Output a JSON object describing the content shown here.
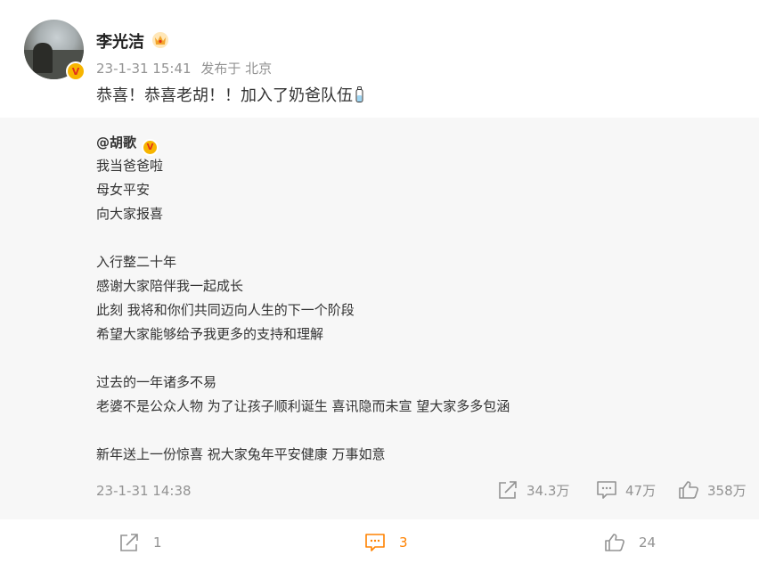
{
  "post": {
    "username": "李光洁",
    "timestamp": "23-1-31 15:41",
    "location": "发布于 北京",
    "text": "恭喜！恭喜老胡！！加入了奶爸队伍"
  },
  "repost": {
    "author": "@胡歌",
    "lines": [
      "我当爸爸啦",
      "母女平安",
      "向大家报喜",
      "",
      "入行整二十年",
      "感谢大家陪伴我一起成长",
      "此刻 我将和你们共同迈向人生的下一个阶段",
      "希望大家能够给予我更多的支持和理解",
      "",
      "过去的一年诸多不易",
      "老婆不是公众人物 为了让孩子顺利诞生 喜讯隐而未宣 望大家多多包涵",
      "",
      "新年送上一份惊喜 祝大家兔年平安健康 万事如意"
    ],
    "timestamp": "23-1-31 14:38",
    "share_count": "34.3万",
    "comment_count": "47万",
    "like_count": "358万"
  },
  "footer": {
    "share_count": "1",
    "comment_count": "3",
    "like_count": "24"
  },
  "colors": {
    "accent": "#ff8200",
    "muted": "#939393",
    "repost_bg": "#f7f7f7",
    "vip_badge": "#f7b500"
  }
}
